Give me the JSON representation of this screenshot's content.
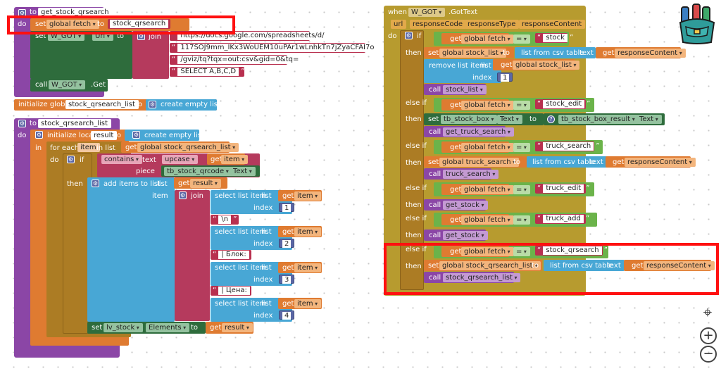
{
  "colors": {
    "procedure": "#8b46a6",
    "event": "#b79b2f",
    "variable": "#df7b31",
    "control": "#ac7c24",
    "logic": "#6bb34a",
    "list": "#48a7d5",
    "text": "#b53a5d",
    "math": "#5b67a5",
    "component": "#2f7d58",
    "set": "#2e6c3c"
  },
  "proc1": {
    "to": "to",
    "name": "get_stock_qrsearch",
    "do": "do",
    "set": "set",
    "var": "global fetch",
    "to2": "to",
    "val": "stock_qrsearch",
    "set2": "set",
    "comp": "W_GOT",
    "prop": "Url",
    "to3": "to",
    "join": "join",
    "url1": "https://docs.google.com/spreadsheets/d/",
    "url2": "117SOJ9mm_IKx3WoUEM10uPAr1wLnhkTn7jZyaCFAI7o",
    "url3": "/gviz/tq?tqx=out:csv&gid=0&tq=",
    "url4": "SELECT A,B,C,D",
    "call": "call",
    "callcomp": "W_GOT",
    "callmethod": ".Get"
  },
  "global": {
    "init": "initialize global",
    "name": "stock_qrsearch_list",
    "to": "to",
    "create": "create empty list"
  },
  "proc2": {
    "to": "to",
    "name": "stock_qrsearch_list",
    "do": "do",
    "initlocal": "initialize local",
    "local": "result",
    "to2": "to",
    "create": "create empty list",
    "in": "in",
    "foreach": "for each",
    "item": "item",
    "inlist": "in list",
    "get": "get",
    "getvar": "global stock_qrsearch_list",
    "do2": "do",
    "if": "if",
    "contains": "contains",
    "text": "text",
    "upcase": "upcase",
    "get2": "get",
    "item2": "item",
    "piece": "piece",
    "tb": "tb_stock_qrcode",
    "textprop": "Text",
    "then": "then",
    "additems": "add items to list",
    "list": "list",
    "get3": "get",
    "result": "result",
    "itemlbl": "item",
    "join": "join",
    "select": "select list item",
    "listlbl": "list",
    "index": "index",
    "getitem": "item",
    "sep1": "\\n",
    "sep2": "| Блок:",
    "sep3": "| Цена:",
    "i1": "1",
    "i2": "2",
    "i3": "3",
    "i4": "4",
    "setlv": "set",
    "lv": "lv_stock",
    "elements": "Elements",
    "to3": "to",
    "get4": "get",
    "result2": "result"
  },
  "event": {
    "when": "when",
    "comp": "W_GOT",
    "evt": ".GotText",
    "p1": "url",
    "p2": "responseCode",
    "p3": "responseType",
    "p4": "responseContent",
    "do": "do",
    "if": "if",
    "then": "then",
    "elseif": "else if",
    "get": "get",
    "fetch": "global fetch",
    "eq": "=",
    "v1": "stock",
    "v2": "stock_edit",
    "v3": "truck_search",
    "v4": "truck_edit",
    "v5": "truck_add",
    "v6": "stock_qrsearch",
    "set": "set",
    "stocklist": "global stock_list",
    "to": "to",
    "csv": "list from csv table",
    "textlbl": "text",
    "rc": "responseContent",
    "remove": "remove list item",
    "list": "list",
    "index": "index",
    "one": "1",
    "call": "call",
    "c1": "stock_list",
    "tbbox": "tb_stock_box",
    "textprop": "Text",
    "q": "?",
    "tbres": "tb_stock_box_result",
    "c2": "get_truck_search",
    "trucksearch": "global truck_search",
    "c3": "truck_search",
    "c4": "get_stock",
    "c5": "get_stock",
    "qrlist": "global stock_qrsearch_list",
    "c6": "stock_qrsearch_list"
  },
  "controls": {
    "target": "⌖",
    "zoomin": "+",
    "zoomout": "−"
  }
}
